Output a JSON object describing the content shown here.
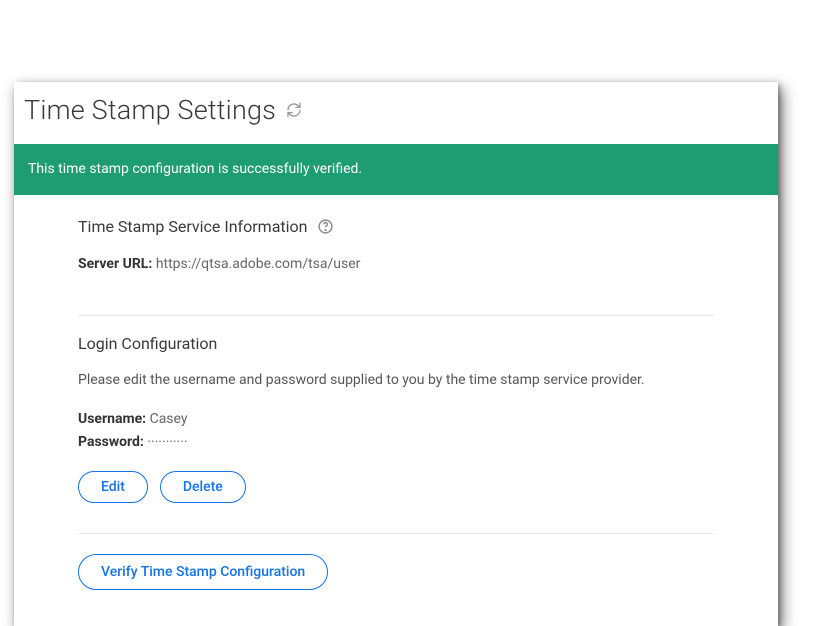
{
  "header": {
    "title": "Time Stamp Settings"
  },
  "banner": {
    "message": "This time stamp configuration is successfully verified."
  },
  "service_info": {
    "title": "Time Stamp Service Information",
    "server_url_label": "Server URL:",
    "server_url_value": "https://qtsa.adobe.com/tsa/user"
  },
  "login_config": {
    "title": "Login Configuration",
    "description": "Please edit the username and password supplied to you by the time stamp service provider.",
    "username_label": "Username:",
    "username_value": "Casey",
    "password_label": "Password:",
    "password_value": "···········",
    "edit_label": "Edit",
    "delete_label": "Delete"
  },
  "verify": {
    "button_label": "Verify Time Stamp Configuration"
  }
}
